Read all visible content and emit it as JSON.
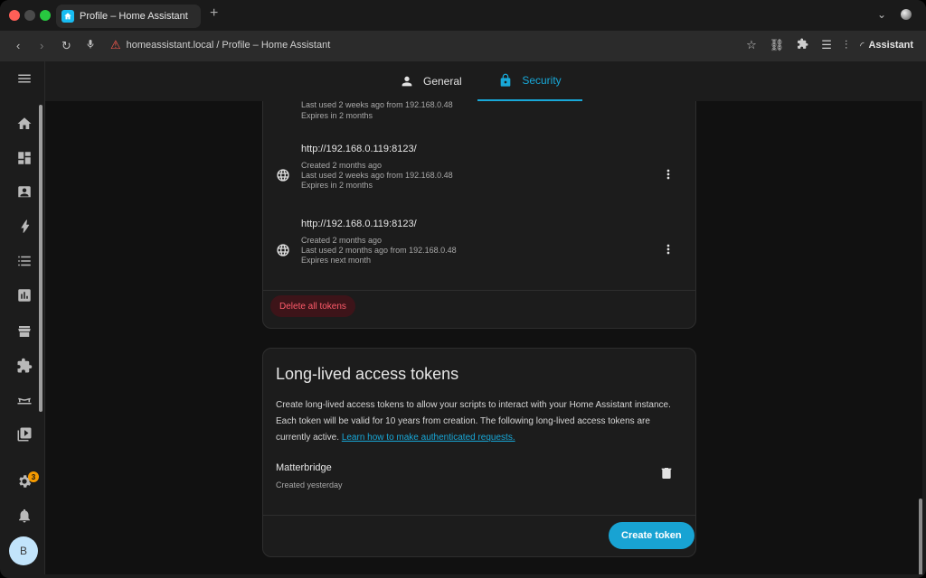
{
  "browser": {
    "tab_title": "Profile – Home Assistant",
    "new_tab": "+",
    "address": "homeassistant.local / Profile – Home Assistant",
    "assistant_label": "Assistant"
  },
  "header": {
    "tabs": [
      {
        "label": "General"
      },
      {
        "label": "Security"
      }
    ]
  },
  "refresh_tokens": {
    "partial": {
      "line1": "Last used 2 weeks ago from 192.168.0.48",
      "line2": "Expires in 2 months"
    },
    "items": [
      {
        "title": "http://192.168.0.119:8123/",
        "created": "Created 2 months ago",
        "last_used": "Last used 2 weeks ago from 192.168.0.48",
        "expires": "Expires in 2 months"
      },
      {
        "title": "http://192.168.0.119:8123/",
        "created": "Created 2 months ago",
        "last_used": "Last used 2 months ago from 192.168.0.48",
        "expires": "Expires next month"
      }
    ],
    "delete_all_label": "Delete all tokens"
  },
  "long_lived": {
    "title": "Long-lived access tokens",
    "description": "Create long-lived access tokens to allow your scripts to interact with your Home Assistant instance. Each token will be valid for 10 years from creation. The following long-lived access tokens are currently active.",
    "link_text": "Learn how to make authenticated requests.",
    "token_name": "Matterbridge",
    "token_created": "Created yesterday",
    "create_label": "Create token"
  },
  "sidebar": {
    "notification_count": "3",
    "avatar_initial": "B"
  },
  "colors": {
    "accent": "#18a8d8",
    "danger": "#ff5b6a",
    "badge": "#f59a00"
  }
}
